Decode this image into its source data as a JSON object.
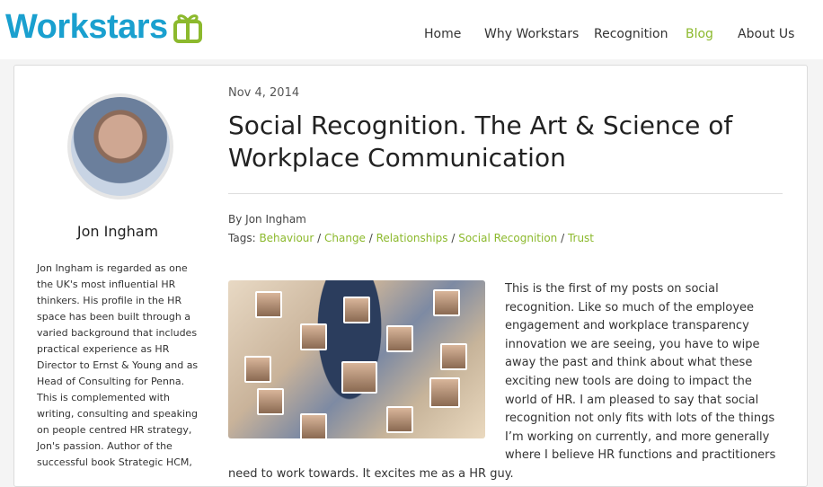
{
  "brand": {
    "name": "Workstars",
    "icon": "gift-box-icon",
    "color": "#1aa0cf"
  },
  "nav": {
    "items": [
      {
        "label": "Home"
      },
      {
        "label": "Why Workstars"
      },
      {
        "label": "Recognition"
      },
      {
        "label": "Blog",
        "active": true
      },
      {
        "label": "About Us"
      }
    ],
    "accent_color": "#8cb92d"
  },
  "author": {
    "name": "Jon Ingham",
    "bio": "Jon Ingham is regarded as one the UK's most influential HR thinkers. His profile in the HR space has been built through a varied background that includes practical experience as HR Director to Ernst & Young and as Head of Consulting for Penna. This is complemented with writing, consulting and speaking on people centred HR strategy, Jon's passion. Author of the successful book Strategic HCM,"
  },
  "post": {
    "date": "Nov 4, 2014",
    "title": "Social Recognition. The Art & Science of Workplace Communication",
    "byline": "By Jon Ingham",
    "tags_label": "Tags:",
    "tags": [
      "Behaviour",
      "Change",
      "Relationships",
      "Social Recognition",
      "Trust"
    ],
    "tag_separator": " / ",
    "body": "This is the first of my posts on social recognition. Like so much of the employee engagement and workplace transparency innovation we are seeing, you have to wipe away the past and think about what these exciting new tools are doing to impact the world of HR. I am pleased to say that social recognition not only fits with lots of the things I’m working on currently, and more generally where I believe HR functions and practitioners need to work towards. It excites me as a HR guy."
  }
}
